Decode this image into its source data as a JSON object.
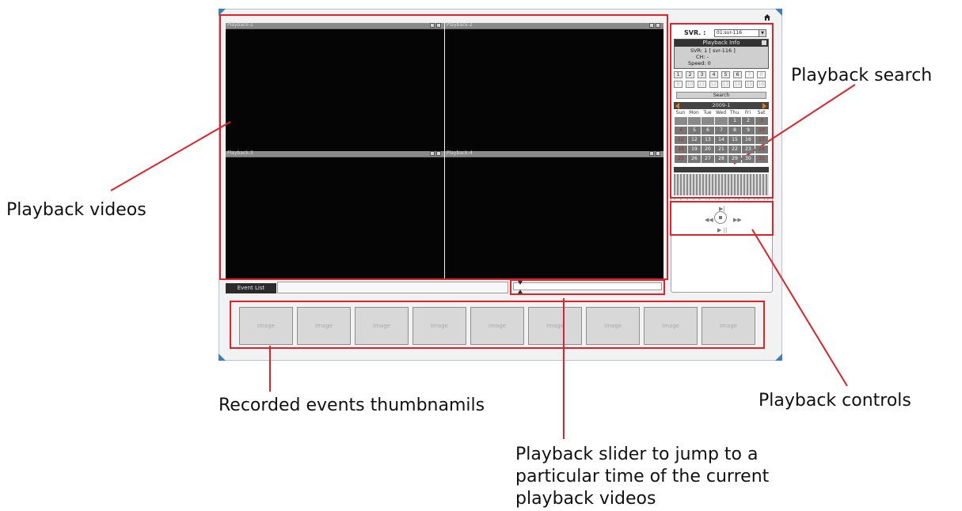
{
  "panes": [
    {
      "title": "Playback-1"
    },
    {
      "title": "Playback-2"
    },
    {
      "title": "Playback-3"
    },
    {
      "title": "Playback-4"
    }
  ],
  "event_list": {
    "tab_label": "Event List"
  },
  "thumbnails": {
    "placeholder": "Image",
    "count": 9
  },
  "right_panel": {
    "svr_label": "SVR. :",
    "svr_value": "01:svr-116",
    "info_title": "Playback Info",
    "info_svr": "SVR:  1 [ svr-116 ]",
    "info_ch": "CH:  -",
    "info_speed": "Speed:  0",
    "channels_row1": [
      "1",
      "2",
      "3",
      "4",
      "5",
      "6",
      "7",
      "8"
    ],
    "channels_row2": [
      "9",
      "10",
      "11",
      "12",
      "13",
      "14",
      "15",
      "16"
    ],
    "search_label": "Search",
    "calendar": {
      "month": "2009-1",
      "weekdays": [
        "Sun",
        "Mon",
        "Tue",
        "Wed",
        "Thu",
        "Fri",
        "Sat"
      ],
      "days": [
        "",
        "",
        "",
        "",
        "1",
        "2",
        "3",
        "4",
        "5",
        "6",
        "7",
        "8",
        "9",
        "10",
        "11",
        "12",
        "13",
        "14",
        "15",
        "16",
        "17",
        "18",
        "19",
        "20",
        "21",
        "22",
        "23",
        "24",
        "25",
        "26",
        "27",
        "28",
        "29",
        "30",
        "31"
      ]
    },
    "timeline_ticks": "0 2 4 6 8 10 12 14 16 18 20 22"
  },
  "annotations": {
    "playback_videos": "Playback videos",
    "playback_search": "Playback search",
    "recorded_events": "Recorded events thumbnamils",
    "playback_controls": "Playback controls",
    "slider_line1": "Playback slider to jump to a",
    "slider_line2": "particular time of the current",
    "slider_line3": "playback videos"
  },
  "colors": {
    "annotation_red": "#e0222a",
    "window_accent": "#3b7dc4"
  }
}
